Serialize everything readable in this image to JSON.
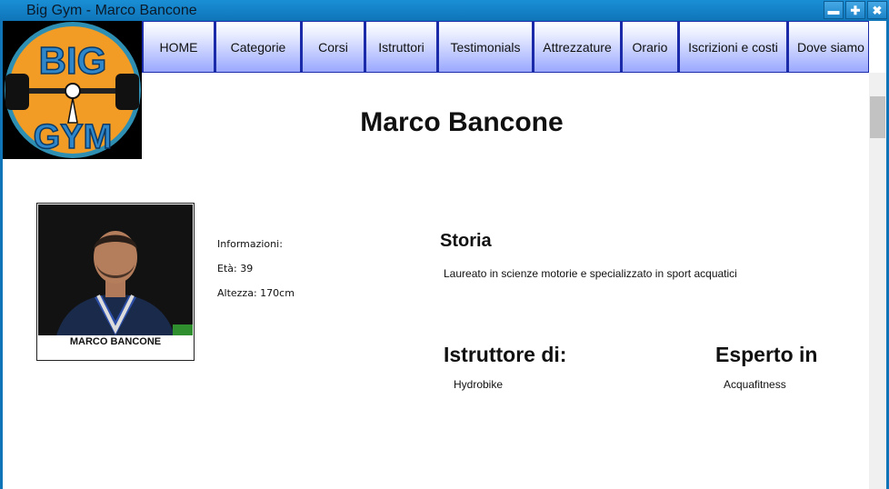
{
  "window": {
    "title": "Big Gym - Marco Bancone",
    "controls": [
      "minimize-icon",
      "maximize-icon",
      "close-icon"
    ]
  },
  "logo": {
    "top_text": "BIG",
    "bottom_text": "GYM",
    "colors": {
      "disc": "#f29c26",
      "ring": "#2f8fb3",
      "letters": "#2f86c9"
    }
  },
  "nav": {
    "items": [
      {
        "label": "HOME"
      },
      {
        "label": "Categorie"
      },
      {
        "label": "Corsi"
      },
      {
        "label": "Istruttori"
      },
      {
        "label": "Testimonials"
      },
      {
        "label": "Attrezzature"
      },
      {
        "label": "Orario"
      },
      {
        "label": "Iscrizioni e costi"
      },
      {
        "label": "Dove siamo"
      }
    ]
  },
  "page": {
    "title": "Marco Bancone"
  },
  "profile": {
    "photo_caption": "MARCO BANCONE",
    "info_label": "Informazioni:",
    "eta": "Età:   39",
    "altezza": "Altezza: 170cm"
  },
  "storia": {
    "heading": "Storia",
    "text": "Laureato in scienze motorie e specializzato in sport acquatici"
  },
  "istruttore": {
    "heading": "Istruttore di:",
    "items": [
      "Hydrobike"
    ]
  },
  "esperto": {
    "heading": "Esperto in",
    "items": [
      "Acquafitness"
    ]
  },
  "theme": {
    "titlebar": "#0f74b8",
    "nav_border": "#1b2aa8",
    "nav_gradient_bottom": "#9aa8ff"
  }
}
